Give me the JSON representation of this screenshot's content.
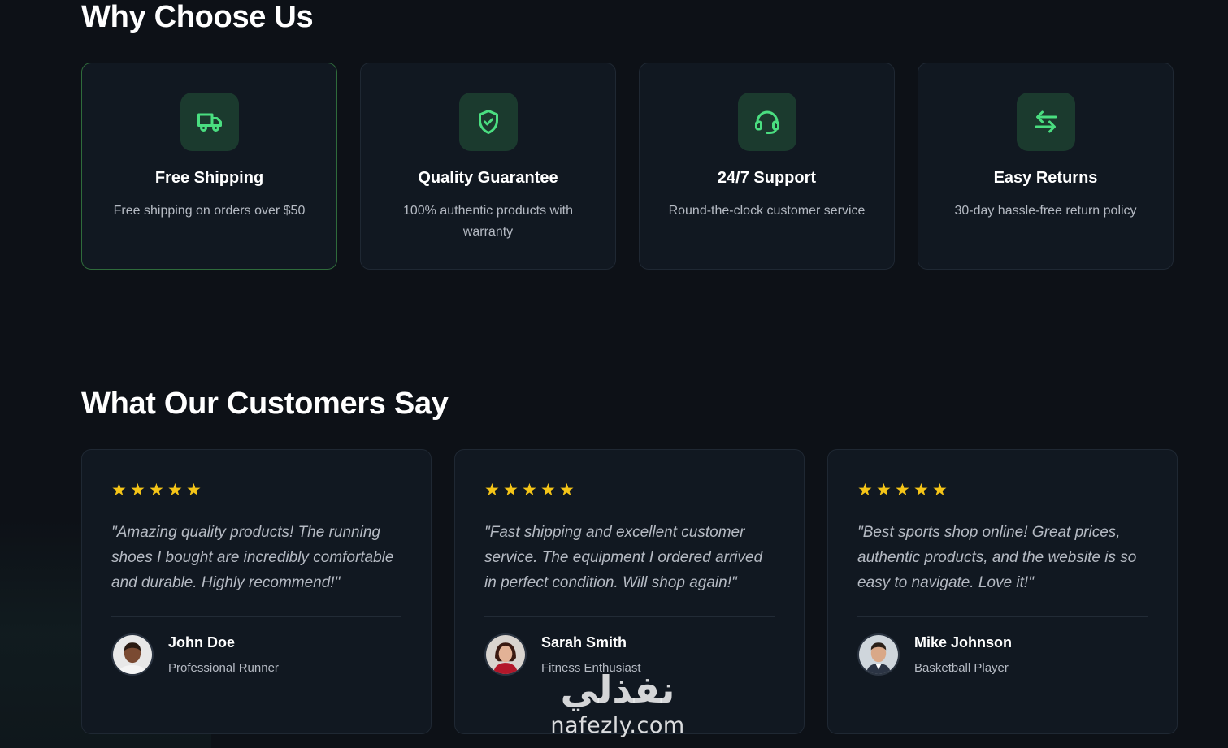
{
  "why_section": {
    "title": "Why Choose Us",
    "features": [
      {
        "icon": "truck-icon",
        "title": "Free Shipping",
        "description": "Free shipping on orders over $50"
      },
      {
        "icon": "shield-check-icon",
        "title": "Quality Guarantee",
        "description": "100% authentic products with warranty"
      },
      {
        "icon": "headset-icon",
        "title": "24/7 Support",
        "description": "Round-the-clock customer service"
      },
      {
        "icon": "swap-arrows-icon",
        "title": "Easy Returns",
        "description": "30-day hassle-free return policy"
      }
    ]
  },
  "testimonials": {
    "title": "What Our Customers Say",
    "items": [
      {
        "rating": 5,
        "quote": "\"Amazing quality products! The running shoes I bought are incredibly comfortable and durable. Highly recommend!\"",
        "name": "John Doe",
        "role": "Professional Runner"
      },
      {
        "rating": 5,
        "quote": "\"Fast shipping and excellent customer service. The equipment I ordered arrived in perfect condition. Will shop again!\"",
        "name": "Sarah Smith",
        "role": "Fitness Enthusiast"
      },
      {
        "rating": 5,
        "quote": "\"Best sports shop online! Great prices, authentic products, and the website is so easy to navigate. Love it!\"",
        "name": "Mike Johnson",
        "role": "Basketball Player"
      }
    ]
  },
  "watermark": {
    "arabic": "نفذلي",
    "latin": "nafezly.com"
  },
  "colors": {
    "accent": "#4ade80",
    "star": "#f5c518",
    "background": "#0d1117",
    "card": "#111821"
  }
}
